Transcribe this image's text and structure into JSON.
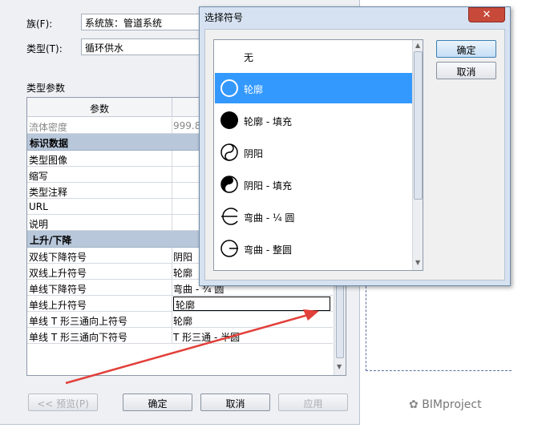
{
  "type_properties": {
    "family_label": "族(F):",
    "family_value": "系统族：管道系统",
    "type_label": "类型(T):",
    "type_value": "循环供水",
    "params_title": "类型参数",
    "header_param": "参数",
    "rows": [
      {
        "kind": "row",
        "name": "流体密度",
        "value": "999.8",
        "dim": true
      },
      {
        "kind": "group",
        "name": "标识数据"
      },
      {
        "kind": "row",
        "name": "类型图像",
        "value": ""
      },
      {
        "kind": "row",
        "name": "缩写",
        "value": ""
      },
      {
        "kind": "row",
        "name": "类型注释",
        "value": ""
      },
      {
        "kind": "row",
        "name": "URL",
        "value": ""
      },
      {
        "kind": "row",
        "name": "说明",
        "value": ""
      },
      {
        "kind": "group",
        "name": "上升/下降"
      },
      {
        "kind": "row",
        "name": "双线下降符号",
        "value": "阴阳"
      },
      {
        "kind": "row",
        "name": "双线上升符号",
        "value": "轮廓"
      },
      {
        "kind": "row",
        "name": "单线下降符号",
        "value": "弯曲 - ¾ 圆"
      },
      {
        "kind": "row",
        "name": "单线上升符号",
        "value": "轮廓",
        "selected": true
      },
      {
        "kind": "row",
        "name": "单线 T 形三通向上符号",
        "value": "轮廓"
      },
      {
        "kind": "row",
        "name": "单线 T 形三通向下符号",
        "value": "T 形三通 - 半圆"
      }
    ],
    "buttons": {
      "preview": "<< 预览(P)",
      "ok": "确定",
      "cancel": "取消",
      "apply": "应用"
    }
  },
  "select_symbol": {
    "title": "选择符号",
    "close_glyph": "✕",
    "items": [
      {
        "label": "无",
        "icon": "none-icon"
      },
      {
        "label": "轮廓",
        "icon": "outline-circle-icon",
        "selected": true
      },
      {
        "label": "轮廓 - 填充",
        "icon": "filled-circle-icon"
      },
      {
        "label": "阴阳",
        "icon": "yin-yang-icon"
      },
      {
        "label": "阴阳 - 填充",
        "icon": "yin-yang-filled-icon"
      },
      {
        "label": "弯曲 - ¼ 圆",
        "icon": "bend-quarter-circle-icon"
      },
      {
        "label": "弯曲 - 整圆",
        "icon": "bend-full-circle-icon"
      }
    ],
    "ok": "确定",
    "cancel": "取消"
  },
  "watermark": "BIMproject",
  "colors": {
    "selection": "#3399ff",
    "arrow": "#e2403a",
    "group_header": "#b8c7da"
  }
}
